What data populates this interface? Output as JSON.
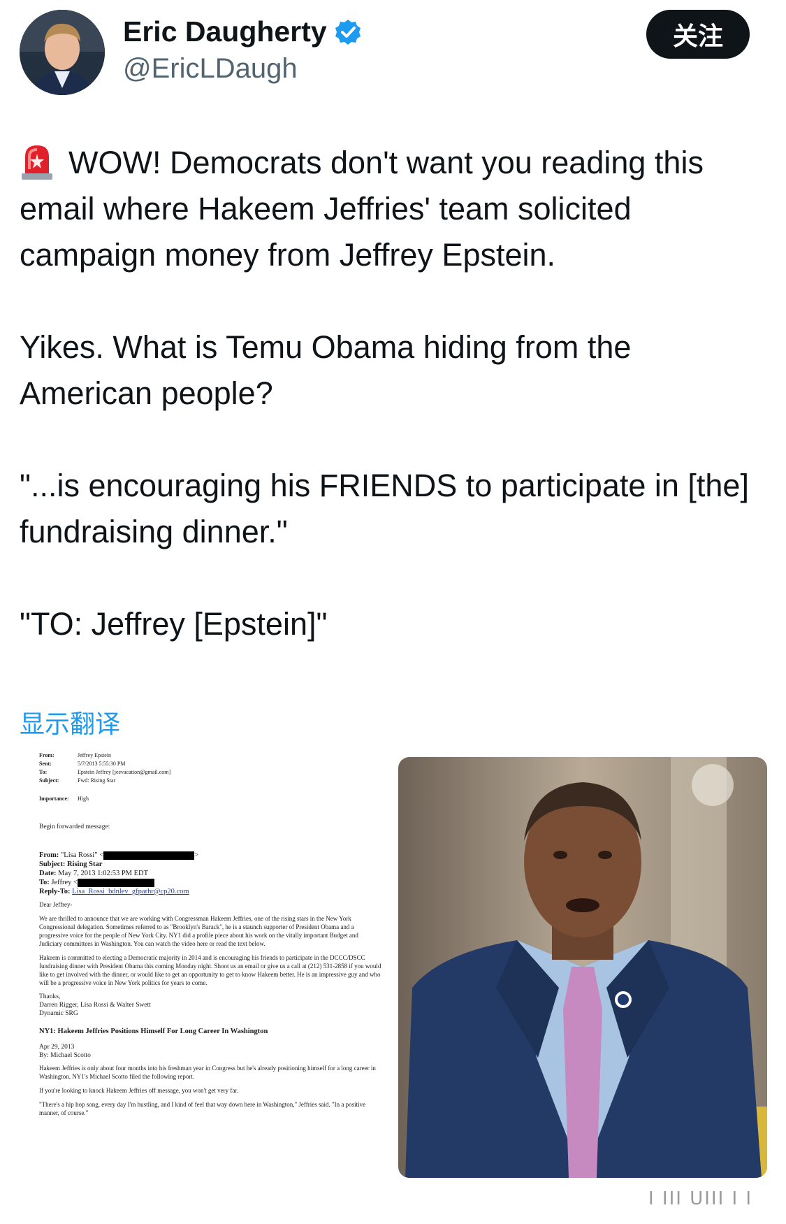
{
  "author": {
    "name": "Eric Daugherty",
    "handle": "@EricLDaugh",
    "follow_label": "关注",
    "verified_color": "#1d9bf0"
  },
  "tweet": {
    "paragraphs": [
      "WOW! Democrats don't want you reading this email where Hakeem Jeffries' team solicited campaign money from Jeffrey Epstein.",
      "Yikes. What is Temu Obama hiding from the American people?",
      "\"...is encouraging his FRIENDS to participate in [the] fundraising dinner.\"",
      "\"TO: Jeffrey [Epstein]\""
    ],
    "leading_icon": "siren-icon",
    "translate_label": "显示翻译"
  },
  "email_document": {
    "header": [
      {
        "k": "From:",
        "v": "Jeffrey Epstein"
      },
      {
        "k": "Sent:",
        "v": "5/7/2013 5:55:30 PM"
      },
      {
        "k": "To:",
        "v": "Epstein Jeffrey [jeevacation@gmail.com]"
      },
      {
        "k": "Subject:",
        "v": "Fwd: Rising Star"
      },
      {
        "k": "Importance:",
        "v": "High"
      }
    ],
    "forwarded": "Begin forwarded message:",
    "fwd_from_label": "From:",
    "fwd_from": "\"Lisa Rossi\" <",
    "fwd_subject_label": "Subject:",
    "fwd_subject": "Rising Star",
    "fwd_date_label": "Date:",
    "fwd_date": "May 7, 2013 1:02:53 PM EDT",
    "fwd_to_label": "To:",
    "fwd_to": "Jeffrey <",
    "fwd_reply_label": "Reply-To:",
    "fwd_reply": "Lisa_Rossi_bdnlev_gfparhr@cp20.com",
    "greeting": "Dear Jeffrey-",
    "para1": "We are thrilled to announce that we are working with Congressman Hakeem Jeffries, one of the rising stars in the New York Congressional delegation. Sometimes referred to as \"Brooklyn's Barack\", he is a staunch supporter of President Obama and a progressive voice for the people of New York City. NY1 did a profile piece about his work on the vitally important Budget and Judiciary committees in Washington. You can watch the video here or read the text below.",
    "para2": "Hakeem is committed to electing a Democratic majority in 2014 and is encouraging his friends to participate in the DCCC/DSCC fundraising dinner with President Obama this coming Monday night. Shoot us an email or give us a call at (212) 531-2858 if you would like to get involved with the dinner, or would like to get an opportunity to get to know Hakeem better. He is an impressive guy and who will be a progressive voice in New York politics for years to come.",
    "thanks": "Thanks,",
    "signers": "Darren Rigger, Lisa Rossi & Walter Swett",
    "org": "Dynamic SRG",
    "headline": "NY1: Hakeem Jeffries Positions Himself For Long Career In Washington",
    "article_date": "Apr 29, 2013",
    "byline": "By: Michael Scotto",
    "a1": "Hakeem Jeffries is only about four months into his freshman year in Congress but he's already positioning himself for a long career in Washington. NY1's Michael Scotto filed the following report.",
    "a2": "If you're looking to knock Hakeem Jeffries off message, you won't get very far.",
    "a3": "\"There's a hip hop song, every day I'm hustling, and I kind of feel that way down here in Washington,\" Jeffries said. \"In a positive manner, of course.\""
  },
  "watermark_text": "I III UIII I I"
}
